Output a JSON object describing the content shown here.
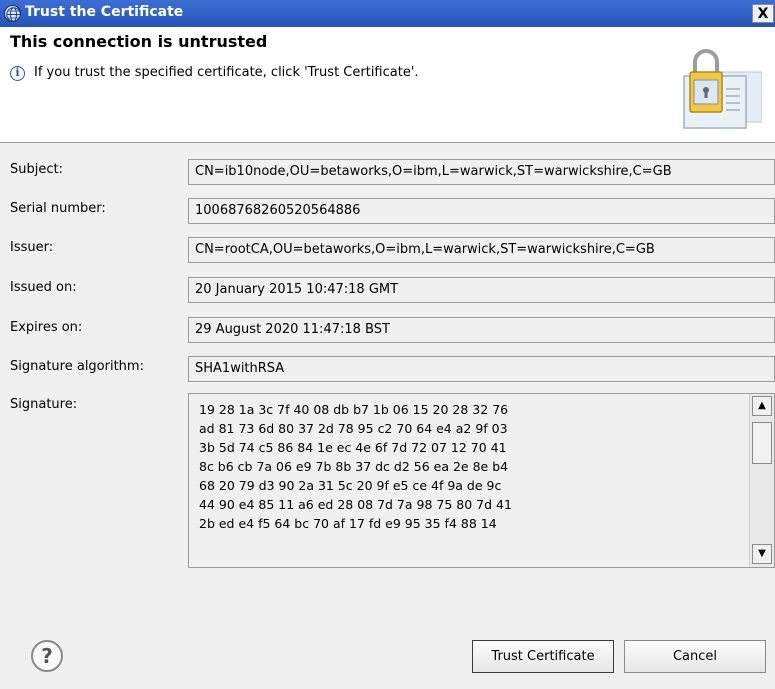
{
  "window": {
    "title": "Trust the Certificate",
    "close_glyph": "X"
  },
  "header": {
    "title": "This connection is untrusted",
    "message": "If you trust the specified certificate, click 'Trust Certificate'.",
    "info_icon": "i"
  },
  "fields": {
    "subject": {
      "label": "Subject:",
      "value": "CN=ib10node,OU=betaworks,O=ibm,L=warwick,ST=warwickshire,C=GB"
    },
    "serial": {
      "label": "Serial number:",
      "value": "10068768260520564886"
    },
    "issuer": {
      "label": "Issuer:",
      "value": "CN=rootCA,OU=betaworks,O=ibm,L=warwick,ST=warwickshire,C=GB"
    },
    "issued_on": {
      "label": "Issued on:",
      "value": "20 January 2015 10:47:18 GMT"
    },
    "expires_on": {
      "label": "Expires on:",
      "value": "29 August 2020 11:47:18 BST"
    },
    "sig_alg": {
      "label": "Signature algorithm:",
      "value": "SHA1withRSA"
    },
    "signature": {
      "label": "Signature:",
      "value": "19 28 1a 3c 7f 40 08 db b7 1b 06 15 20 28 32 76\nad 81 73 6d 80 37 2d 78 95 c2 70 64 e4 a2 9f 03\n3b 5d 74 c5 86 84 1e ec 4e 6f 7d 72 07 12 70 41\n8c b6 cb 7a 06 e9 7b 8b 37 dc d2 56 ea 2e 8e b4\n68 20 79 d3 90 2a 31 5c 20 9f e5 ce 4f 9a de 9c\n44 90 e4 85 11 a6 ed 28 08 7d 7a 98 75 80 7d 41\n2b ed e4 f5 64 bc 70 af 17 fd e9 95 35 f4 88 14"
    }
  },
  "buttons": {
    "help": "?",
    "trust": "Trust Certificate",
    "cancel": "Cancel"
  },
  "icons": {
    "title": "globe-icon",
    "info": "info-icon",
    "certificate": "certificate-lock-icon",
    "help": "help-icon"
  },
  "colors": {
    "title_bar": "#2f5fc7",
    "dialog_bg": "#f0f0f0",
    "header_bg": "#ffffff"
  }
}
